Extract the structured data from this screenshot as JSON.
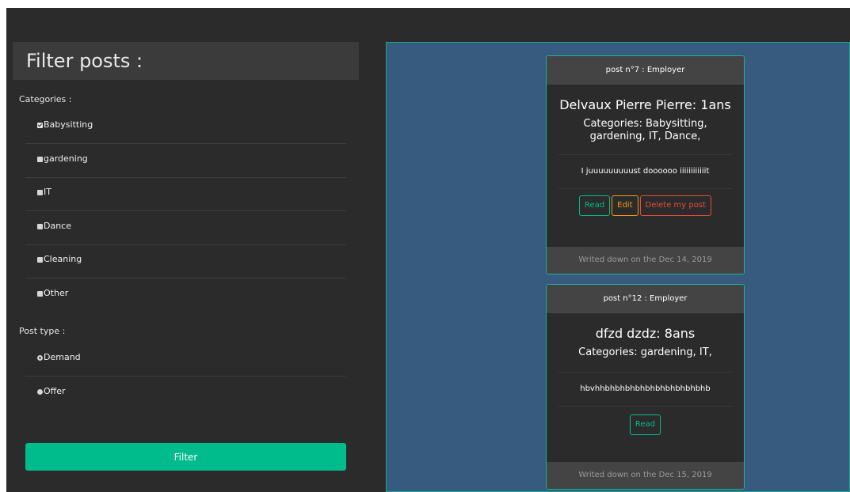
{
  "sidebar": {
    "title": "Filter posts :",
    "categories_label": "Categories :",
    "categories": [
      {
        "label": "Babysitting",
        "checked": true
      },
      {
        "label": "gardening",
        "checked": false
      },
      {
        "label": "IT",
        "checked": false
      },
      {
        "label": "Dance",
        "checked": false
      },
      {
        "label": "Cleaning",
        "checked": false
      },
      {
        "label": "Other",
        "checked": false
      }
    ],
    "post_type_label": "Post type :",
    "post_types": [
      {
        "label": "Demand",
        "checked": true
      },
      {
        "label": "Offer",
        "checked": false
      }
    ],
    "filter_button": "Filter"
  },
  "posts": [
    {
      "header": "post n°7 : Employer",
      "title": "Delvaux Pierre  Pierre: 1ans",
      "categories": "Categories: Babysitting, gardening, IT, Dance,",
      "text": "I juuuuuuuuust doooooo iiiiiiiiiiiit",
      "read_label": "Read",
      "edit_label": "Edit",
      "delete_label": "Delete my post",
      "footer": "Writed down on the Dec 14, 2019"
    },
    {
      "header": "post n°12 : Employer",
      "title": "dfzd  dzdz: 8ans",
      "categories": "Categories: gardening, IT,",
      "text": "hbvhhbhbhbhbhbhbhbhbhbhbhb",
      "read_label": "Read",
      "footer": "Writed down on the Dec 15, 2019"
    }
  ],
  "colors": {
    "page_bg": "#2b2b2b",
    "panel_bg": "#375a7f",
    "accent_green": "#00bc8c",
    "edit_orange": "#f39c12",
    "delete_red": "#e74c3c"
  }
}
